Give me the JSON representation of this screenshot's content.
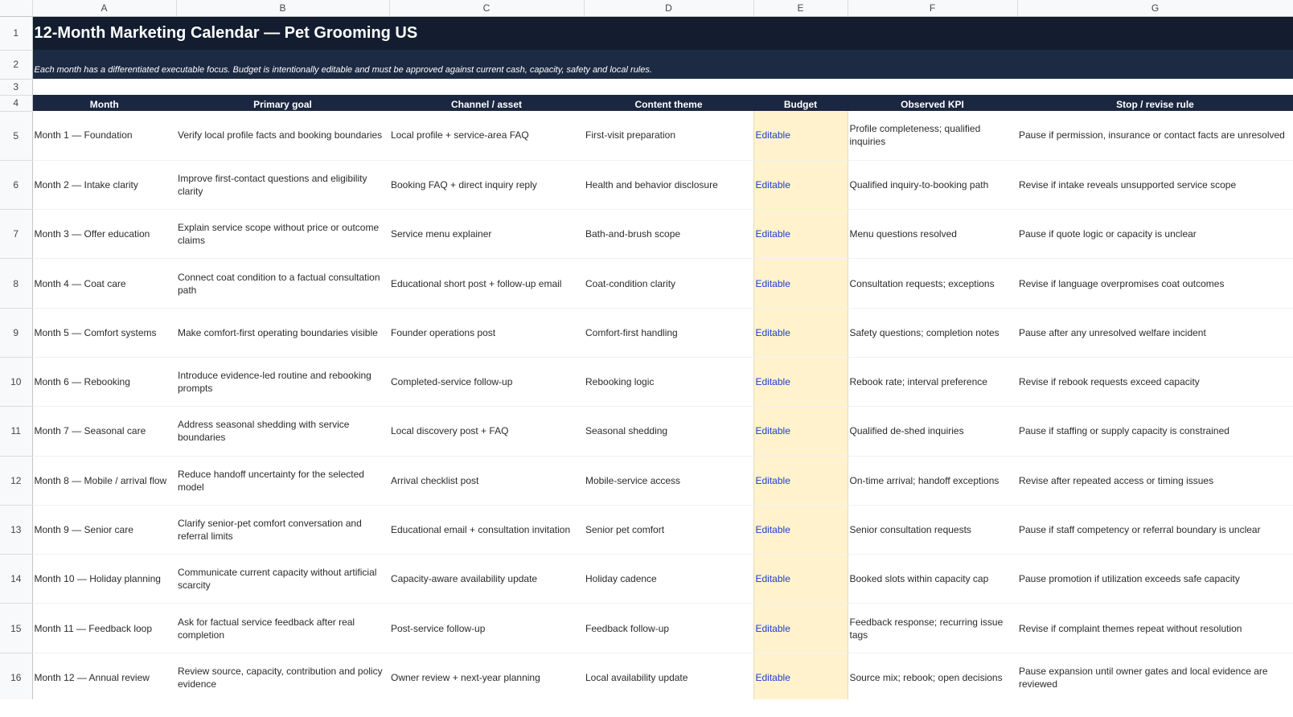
{
  "app": {
    "column_letters": [
      "A",
      "B",
      "C",
      "D",
      "E",
      "F",
      "G"
    ]
  },
  "title": "12-Month Marketing Calendar — Pet Grooming US",
  "subtitle": "Each month has a differentiated executable focus. Budget is intentionally editable and must be approved against current cash, capacity, safety and local rules.",
  "headers": [
    "Month",
    "Primary goal",
    "Channel / asset",
    "Content theme",
    "Budget",
    "Observed KPI",
    "Stop / revise rule"
  ],
  "row_numbers": [
    "1",
    "2",
    "3",
    "4",
    "5",
    "6",
    "7",
    "8",
    "9",
    "10",
    "11",
    "12",
    "13",
    "14",
    "15",
    "16"
  ],
  "rows": [
    {
      "month": "Month 1 — Foundation",
      "goal": "Verify local profile facts and booking boundaries",
      "channel": "Local profile + service-area FAQ",
      "theme": "First-visit preparation",
      "budget": "Editable",
      "kpi": "Profile completeness; qualified inquiries",
      "rule": "Pause if permission, insurance or contact facts are unresolved"
    },
    {
      "month": "Month 2 — Intake clarity",
      "goal": "Improve first-contact questions and eligibility clarity",
      "channel": "Booking FAQ + direct inquiry reply",
      "theme": "Health and behavior disclosure",
      "budget": "Editable",
      "kpi": "Qualified inquiry-to-booking path",
      "rule": "Revise if intake reveals unsupported service scope"
    },
    {
      "month": "Month 3 — Offer education",
      "goal": "Explain service scope without price or outcome claims",
      "channel": "Service menu explainer",
      "theme": "Bath-and-brush scope",
      "budget": "Editable",
      "kpi": "Menu questions resolved",
      "rule": "Pause if quote logic or capacity is unclear"
    },
    {
      "month": "Month 4 — Coat care",
      "goal": "Connect coat condition to a factual consultation path",
      "channel": "Educational short post + follow-up email",
      "theme": "Coat-condition clarity",
      "budget": "Editable",
      "kpi": "Consultation requests; exceptions",
      "rule": "Revise if language overpromises coat outcomes"
    },
    {
      "month": "Month 5 — Comfort systems",
      "goal": "Make comfort-first operating boundaries visible",
      "channel": "Founder operations post",
      "theme": "Comfort-first handling",
      "budget": "Editable",
      "kpi": "Safety questions; completion notes",
      "rule": "Pause after any unresolved welfare incident"
    },
    {
      "month": "Month 6 — Rebooking",
      "goal": "Introduce evidence-led routine and rebooking prompts",
      "channel": "Completed-service follow-up",
      "theme": "Rebooking logic",
      "budget": "Editable",
      "kpi": "Rebook rate; interval preference",
      "rule": "Revise if rebook requests exceed capacity"
    },
    {
      "month": "Month 7 — Seasonal care",
      "goal": "Address seasonal shedding with service boundaries",
      "channel": "Local discovery post + FAQ",
      "theme": "Seasonal shedding",
      "budget": "Editable",
      "kpi": "Qualified de-shed inquiries",
      "rule": "Pause if staffing or supply capacity is constrained"
    },
    {
      "month": "Month 8 — Mobile / arrival flow",
      "goal": "Reduce handoff uncertainty for the selected model",
      "channel": "Arrival checklist post",
      "theme": "Mobile-service access",
      "budget": "Editable",
      "kpi": "On-time arrival; handoff exceptions",
      "rule": "Revise after repeated access or timing issues"
    },
    {
      "month": "Month 9 — Senior care",
      "goal": "Clarify senior-pet comfort conversation and referral limits",
      "channel": "Educational email + consultation invitation",
      "theme": "Senior pet comfort",
      "budget": "Editable",
      "kpi": "Senior consultation requests",
      "rule": "Pause if staff competency or referral boundary is unclear"
    },
    {
      "month": "Month 10 — Holiday planning",
      "goal": "Communicate current capacity without artificial scarcity",
      "channel": "Capacity-aware availability update",
      "theme": "Holiday cadence",
      "budget": "Editable",
      "kpi": "Booked slots within capacity cap",
      "rule": "Pause promotion if utilization exceeds safe capacity"
    },
    {
      "month": "Month 11 — Feedback loop",
      "goal": "Ask for factual service feedback after real completion",
      "channel": "Post-service follow-up",
      "theme": "Feedback follow-up",
      "budget": "Editable",
      "kpi": "Feedback response; recurring issue tags",
      "rule": "Revise if complaint themes repeat without resolution"
    },
    {
      "month": "Month 12 — Annual review",
      "goal": "Review source, capacity, contribution and policy evidence",
      "channel": "Owner review + next-year planning",
      "theme": "Local availability update",
      "budget": "Editable",
      "kpi": "Source mix; rebook; open decisions",
      "rule": "Pause expansion until owner gates and local evidence are reviewed"
    }
  ]
}
